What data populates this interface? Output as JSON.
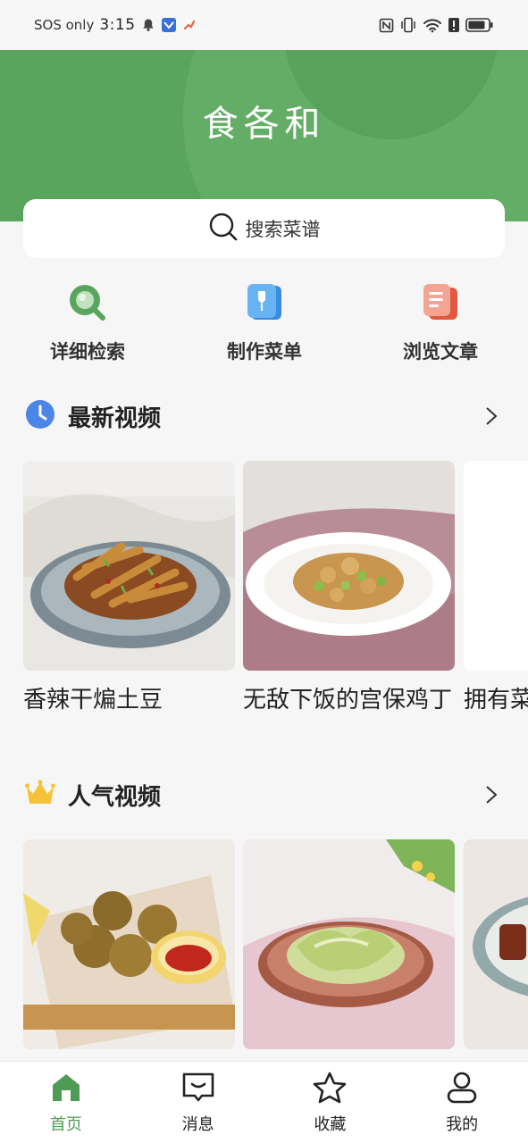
{
  "status_bar": {
    "carrier": "SOS only",
    "time": "3:15"
  },
  "header": {
    "logo": "食各和"
  },
  "search": {
    "placeholder": "搜索菜谱"
  },
  "quick_actions": [
    {
      "label": "详细检索",
      "icon": "magnifier-icon"
    },
    {
      "label": "制作菜单",
      "icon": "menu-book-icon"
    },
    {
      "label": "浏览文章",
      "icon": "article-icon"
    }
  ],
  "latest": {
    "title": "最新视频",
    "items": [
      {
        "title": "香辣干煸土豆"
      },
      {
        "title": "无敌下饭的宫保鸡丁"
      },
      {
        "title": "拥有菜"
      }
    ]
  },
  "popular": {
    "title": "人气视频"
  },
  "bottom_nav": [
    {
      "label": "首页",
      "active": true
    },
    {
      "label": "消息",
      "active": false
    },
    {
      "label": "收藏",
      "active": false
    },
    {
      "label": "我的",
      "active": false
    }
  ],
  "colors": {
    "brand_green": "#5aa55e",
    "active_green": "#4f9b55",
    "clock_blue": "#4a86e8",
    "crown_gold": "#f5c23a"
  }
}
